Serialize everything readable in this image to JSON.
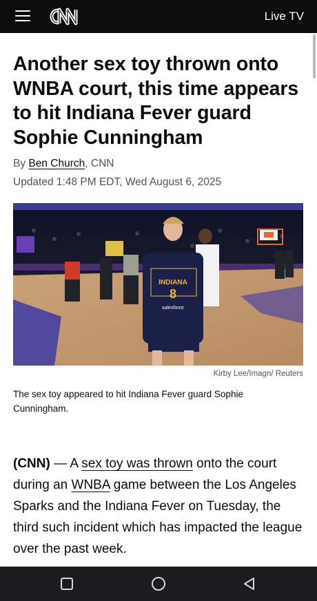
{
  "header": {
    "brand": "CNN",
    "live_tv_label": "Live TV",
    "menu_icon": "hamburger-menu-icon"
  },
  "article": {
    "headline": "Another sex toy thrown onto WNBA court, this time appears to hit Indiana Fever guard Sophie Cunningham",
    "byline_prefix": "By ",
    "author": "Ben Church",
    "byline_suffix": ", CNN",
    "updated": "Updated 1:48 PM EDT, Wed August 6, 2025",
    "image": {
      "jersey_team": "INDIANA",
      "jersey_number": "8",
      "jersey_sponsor": "salesforce",
      "credit": "Kirby Lee/Imagn/ Reuters",
      "caption": "The sex toy appeared to hit Indiana Fever guard Sophie Cunningham."
    },
    "body": {
      "dateline": "(CNN)",
      "dash": " — A ",
      "link1": "sex toy was thrown",
      "text1": " onto the court during an ",
      "link2": "WNBA",
      "text2": " game between the Los Angeles Sparks and the Indiana Fever on Tuesday, the third such incident which has impacted the league over the past week."
    }
  },
  "nav": {
    "recents_icon": "square-recents-icon",
    "home_icon": "circle-home-icon",
    "back_icon": "triangle-back-icon"
  },
  "colors": {
    "header_bg": "#0c0c0c",
    "text": "#0c0c0c",
    "muted": "#555555",
    "nav_bg": "#1c1c1e"
  }
}
